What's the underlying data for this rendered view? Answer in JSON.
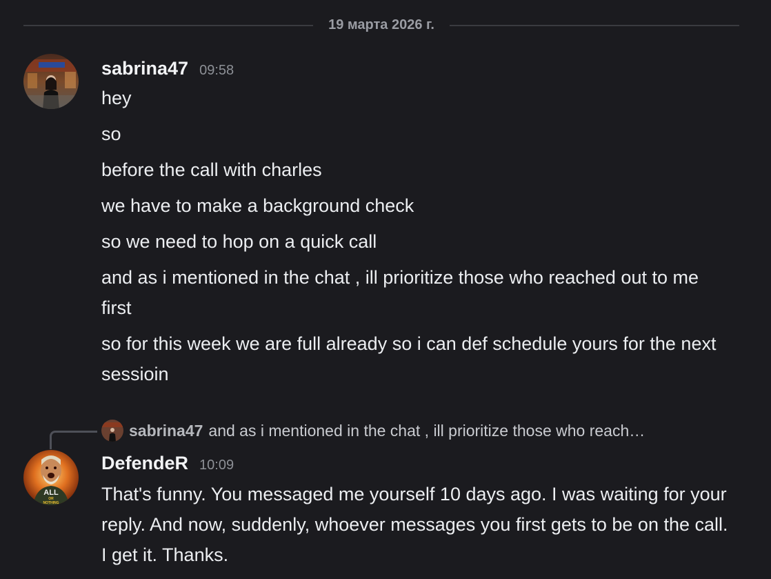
{
  "date_divider": "19 марта 2026 г.",
  "messages": [
    {
      "username": "sabrina47",
      "time": "09:58",
      "avatar_icon": "user-photo-avatar",
      "lines": [
        "hey",
        "so",
        "before the call with charles",
        "we have to make a background check",
        "so we need to hop on a quick call",
        "and as i mentioned in the chat , ill prioritize those who reached out to me first",
        "so for this week we are full already so i can def schedule yours for the next sessioin"
      ]
    },
    {
      "username": "DefendeR",
      "time": "10:09",
      "avatar_icon": "all-or-nothing-avatar",
      "avatar_text_top": "ALL",
      "avatar_text_mid": "OR",
      "avatar_text_bottom": "NOTHING",
      "reply": {
        "username": "sabrina47",
        "text": "and as i mentioned in the chat , ill prioritize those who reach…"
      },
      "lines": [
        "That's funny. You messaged me yourself 10 days ago. I was waiting for your reply. And now, suddenly, whoever messages you first gets to be on the call. I get it. Thanks."
      ]
    }
  ],
  "colors": {
    "background": "#1b1b1f",
    "username": "#f2f3f5",
    "text": "#eceef1",
    "muted": "#8d9096"
  }
}
